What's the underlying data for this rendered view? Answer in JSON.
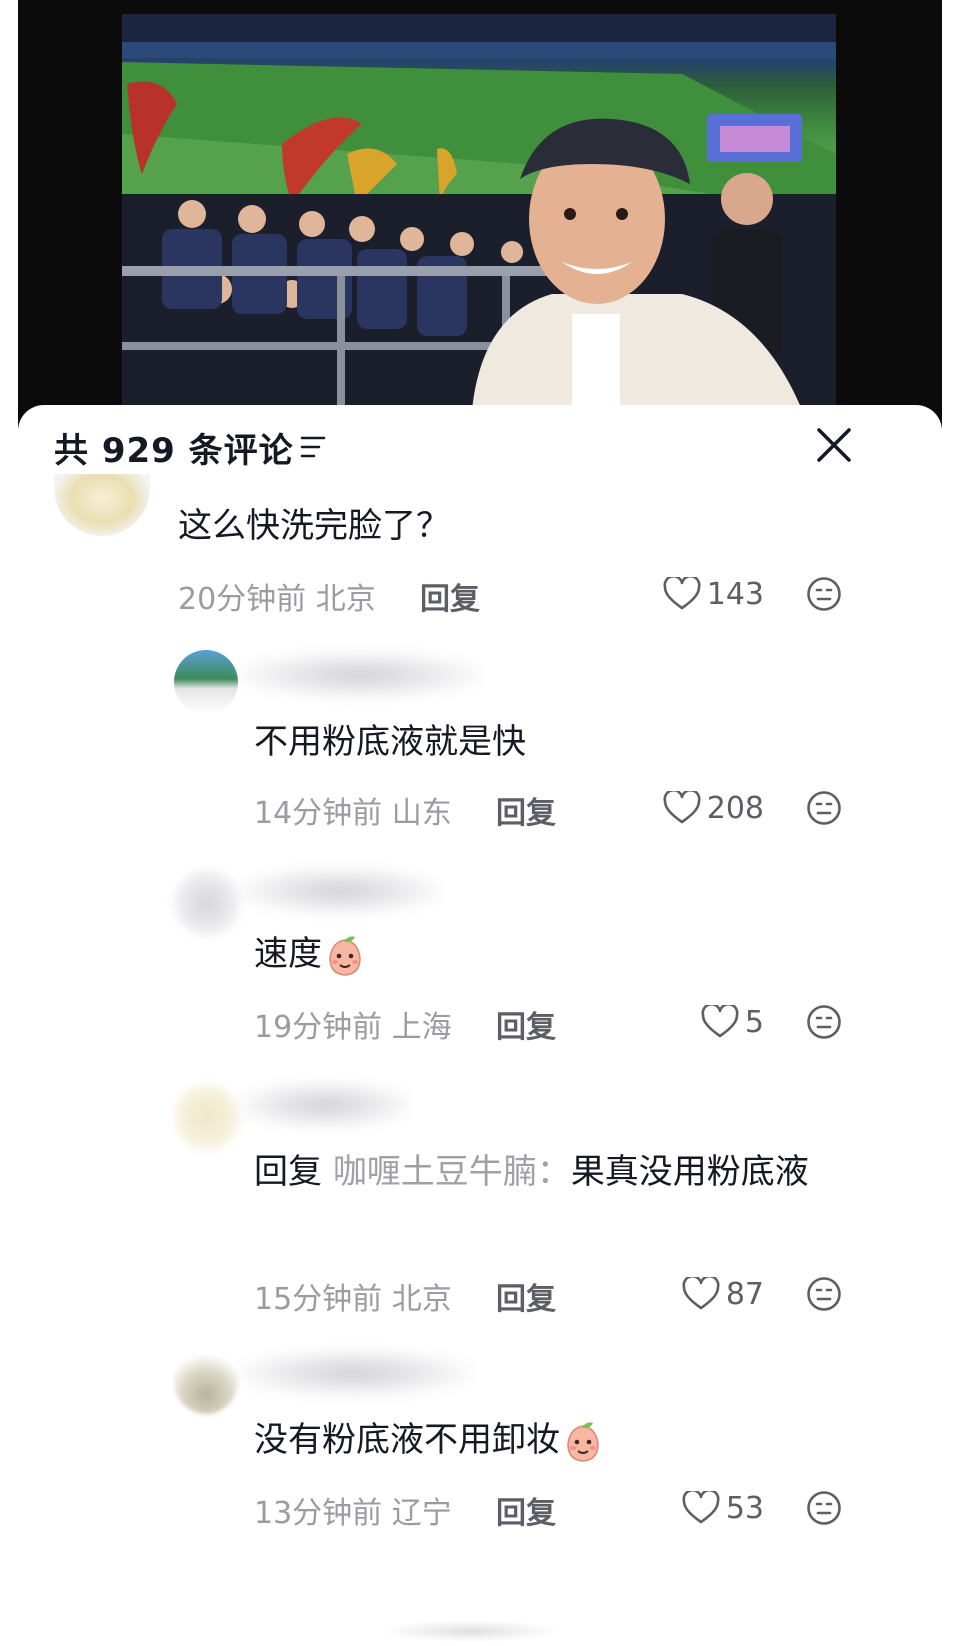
{
  "header": {
    "count_label": "共 929 条评论"
  },
  "comments": [
    {
      "text": "这么快洗完脸了？",
      "time": "20分钟前",
      "location": "北京",
      "reply_label": "回复",
      "likes": "143"
    },
    {
      "text": "不用粉底液就是快",
      "time": "14分钟前",
      "location": "山东",
      "reply_label": "回复",
      "likes": "208"
    },
    {
      "text": "速度",
      "time": "19分钟前",
      "location": "上海",
      "reply_label": "回复",
      "likes": "5"
    },
    {
      "prefix": "回复",
      "reply_to": "咖喱土豆牛腩",
      "colon": "：",
      "text": "果真没用粉底液",
      "time": "15分钟前",
      "location": "北京",
      "reply_label": "回复",
      "likes": "87"
    },
    {
      "text": "没有粉底液不用卸妆",
      "time": "13分钟前",
      "location": "辽宁",
      "reply_label": "回复",
      "likes": "53"
    }
  ],
  "icons": {
    "sort": "sort-lines-icon",
    "close": "close-icon",
    "like": "heart-outline-icon",
    "dislike": "neutral-face-icon",
    "emoji": "peach-emoji-icon"
  },
  "colors": {
    "text": "#161823",
    "meta": "#9b9ba3",
    "action": "#5d5e66"
  }
}
